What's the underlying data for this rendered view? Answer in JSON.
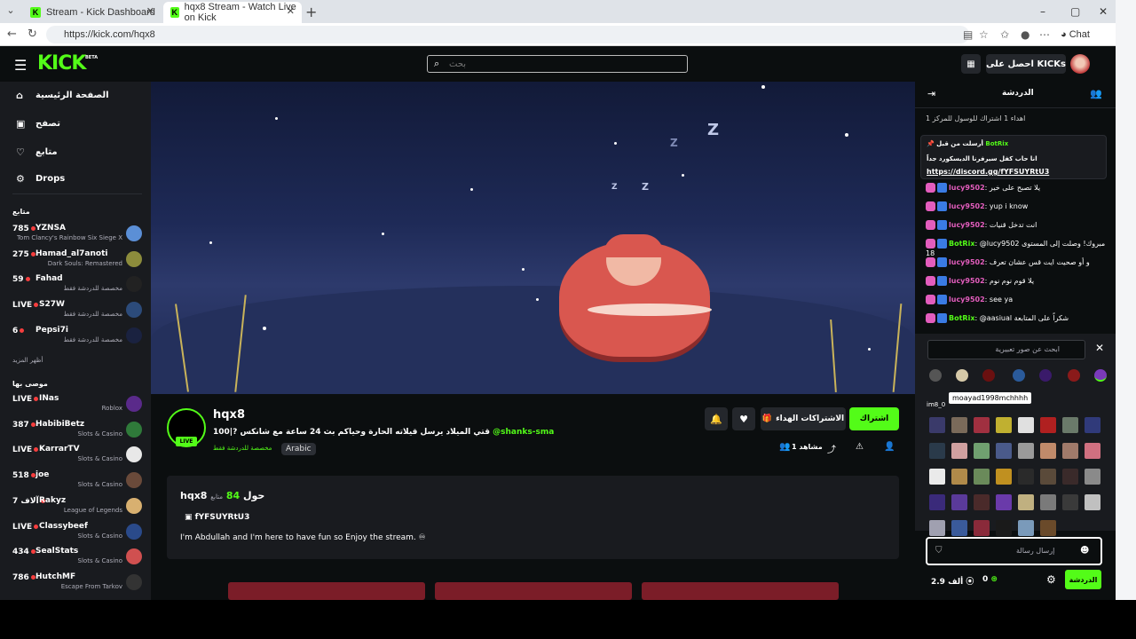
{
  "browser": {
    "tabs": [
      {
        "label": "Stream - Kick Dashboard"
      },
      {
        "label": "hqx8 Stream - Watch Live on Kick"
      }
    ],
    "url": "https://kick.com/hqx8",
    "chat_button": "Chat"
  },
  "header": {
    "logo": "KICK",
    "beta": "BETA",
    "search_placeholder": "بحث",
    "get_kicks": "احصل على KICKs"
  },
  "sidebar": {
    "nav": [
      {
        "label": "الصفحة الرئيسية",
        "icon": "home-icon"
      },
      {
        "label": "تصفح",
        "icon": "browse-icon"
      },
      {
        "label": "متابع",
        "icon": "heart-icon"
      },
      {
        "label": "Drops",
        "icon": "drops-icon"
      }
    ],
    "following_heading": "متابع",
    "following": [
      {
        "count": "785",
        "name": "YZNSA",
        "category": "Tom Clancy's Rainbow Six Siege X",
        "avatar": "#5b8fd6"
      },
      {
        "count": "275",
        "name": "Hamad_al7anoti",
        "category": "Dark Souls: Remastered",
        "avatar": "#8c8c3c"
      },
      {
        "count": "59",
        "name": "Fahad",
        "category": "مخصصة للدردشة فقط",
        "avatar": "#222222"
      },
      {
        "count": "LIVE",
        "name": "S27W",
        "category": "مخصصة للدردشة فقط",
        "avatar": "#2c4b7a"
      },
      {
        "count": "6",
        "name": "Pepsi7i",
        "category": "مخصصة للدردشة فقط",
        "avatar": "#1a2240"
      }
    ],
    "show_more": "أظهر المزيد",
    "recommended_heading": "موصى بها",
    "recommended": [
      {
        "count": "LIVE",
        "name": "INas",
        "category": "Roblox",
        "avatar": "#5a2a8a"
      },
      {
        "count": "387",
        "name": "HabibiBetz",
        "category": "Slots & Casino",
        "avatar": "#2f7a3a"
      },
      {
        "count": "LIVE",
        "name": "KarrarTV",
        "category": "Slots & Casino",
        "avatar": "#e8e8e8"
      },
      {
        "count": "518",
        "name": "joe",
        "category": "Slots & Casino",
        "avatar": "#6a4a3a"
      },
      {
        "count": "7 آلاف",
        "name": "Rakyz",
        "category": "League of Legends",
        "avatar": "#d8b070"
      },
      {
        "count": "LIVE",
        "name": "Classybeef",
        "category": "Slots & Casino",
        "avatar": "#2a4a8a"
      },
      {
        "count": "434",
        "name": "SealStats",
        "category": "Slots & Casino",
        "avatar": "#d05050"
      },
      {
        "count": "786",
        "name": "HutchMF",
        "category": "Escape From Tarkov",
        "avatar": "#333333"
      }
    ]
  },
  "video": {
    "zz": [
      "Z",
      "Z",
      "Z",
      "Z"
    ]
  },
  "stream": {
    "streamer": "hqx8",
    "live_badge": "LIVE",
    "title_mention": "@shanks-sma",
    "title_text": "قتي الميلاد يرسل قيلاته الحارة وحياكم بث 24 ساعة مع شانكس ?|100",
    "category": "مخصصة للدردشة فقط",
    "language": "Arabic",
    "subscribe": "اشتراك",
    "gift_subs": "الاشتراكات الهداء",
    "viewers_label": "مشاهد",
    "viewers": "1"
  },
  "about": {
    "followers_count": "84",
    "followers_label": "متابع",
    "heading": "hqx8 حول",
    "discord": "fYFSUYRtU3",
    "bio": "I'm Abdullah and I'm here to have fun so Enjoy the stream. ♾"
  },
  "chat": {
    "title": "الدردشة",
    "pinned_sub": "اهداء 1 اشتراك للوسول للمركز 1",
    "pinned_by": "أرسلت من قبل",
    "pinned_user": "BotRix",
    "pinned_text": "انا حاب كفل سيرفرنا الديسكورد جداً",
    "pinned_link": "https://discord.gg/fYFSUYRtU3",
    "messages": [
      {
        "user": "lucy9502",
        "text": "يلا تصبح على خير",
        "color": "#e35dbd"
      },
      {
        "user": "lucy9502",
        "text": "yup i know",
        "color": "#e35dbd"
      },
      {
        "user": "lucy9502",
        "text": "انت تدخل قنيات",
        "color": "#e35dbd"
      },
      {
        "user": "BotRix",
        "text": "@lucy9502 مبروك! وصلت إلى المستوى 18",
        "color": "#53fc18"
      },
      {
        "user": "lucy9502",
        "text": "و أو صحيت ايت قس عشان تعرف",
        "color": "#e35dbd"
      },
      {
        "user": "lucy9502",
        "text": "يلا قوم نوم نوم",
        "color": "#e35dbd"
      },
      {
        "user": "lucy9502",
        "text": "see ya",
        "color": "#e35dbd"
      },
      {
        "user": "BotRix",
        "text": "@aasiual شكراً على المتابعة",
        "color": "#53fc18"
      }
    ],
    "emote_search_placeholder": "ابحث عن صور تعبيرية",
    "emote_set_label": "im8_0",
    "emote_tooltip": "moayad1998mchhhh",
    "input_placeholder": "إرسال رسالة",
    "kicks_count": "2.9 ألف",
    "zero_count": "0",
    "send_label": "الدردشة"
  },
  "colors": {
    "accent": "#53fc18",
    "bg": "#0b0e0f",
    "panel": "#191b1f"
  }
}
